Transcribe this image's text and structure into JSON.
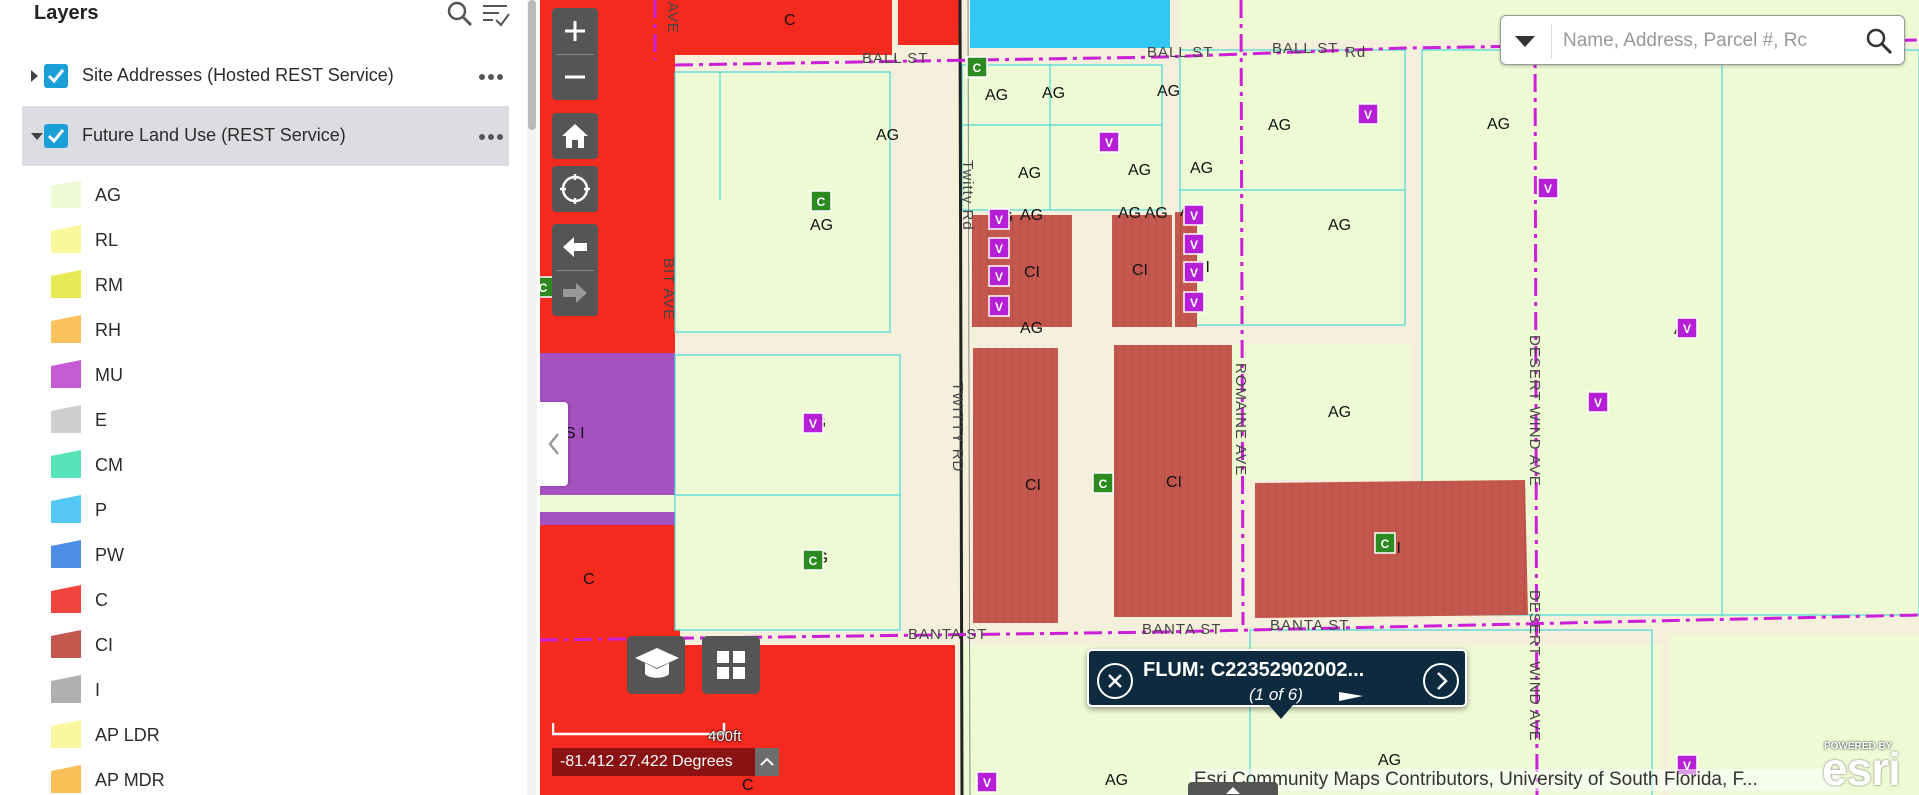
{
  "panel": {
    "title": "Layers",
    "layers": [
      {
        "label": "Site Addresses (Hosted REST Service)",
        "checked": true,
        "expanded": false
      },
      {
        "label": "Future Land Use (REST Service)",
        "checked": true,
        "expanded": true
      }
    ],
    "legend": [
      {
        "code": "AG",
        "color": "#eefad4"
      },
      {
        "code": "RL",
        "color": "#fbf79b"
      },
      {
        "code": "RM",
        "color": "#e6ea55"
      },
      {
        "code": "RH",
        "color": "#fbc15c"
      },
      {
        "code": "MU",
        "color": "#c65bd6"
      },
      {
        "code": "E",
        "color": "#cfcfcf"
      },
      {
        "code": "CM",
        "color": "#58e3b9"
      },
      {
        "code": "P",
        "color": "#55c8f5"
      },
      {
        "code": "PW",
        "color": "#4f8ee6"
      },
      {
        "code": "C",
        "color": "#f0453f"
      },
      {
        "code": "CI",
        "color": "#c4584e"
      },
      {
        "code": "I",
        "color": "#b0b0b0"
      },
      {
        "code": "AP LDR",
        "color": "#fbf7a0"
      },
      {
        "code": "AP MDR",
        "color": "#fbbf58"
      }
    ]
  },
  "map": {
    "search_placeholder": "Name, Address, Parcel #, Rc",
    "roads": {
      "ball_st": "BALL ST",
      "banta_st": "BANTA ST",
      "twitty_rd": "TWITTY RD",
      "twitty_rd_small": "Twitty Rd",
      "romaine_ave": "ROMAINE AVE",
      "desert_wind_ave": "DESERT WIND AVE",
      "bit_ave": "BIT AVE",
      "rd": "Rd",
      "ave": "AVE"
    },
    "labels": {
      "ag": "AG",
      "ci": "CI",
      "c": "C",
      "si": "S I",
      "ag_ag": "AG AG",
      "marker_v": "V",
      "marker_c": "C"
    },
    "popup": {
      "title": "FLUM: C22352902002...",
      "count": "(1 of 6)"
    },
    "scale_label": "400ft",
    "coordinates": "-81.412 27.422 Degrees",
    "attribution": "Esri Community Maps Contributors, University of South Florida, F...",
    "esri_powered": "POWERED BY",
    "esri_word": "esri",
    "colors": {
      "ag": "#eefad4",
      "commercial": "#f52a1f",
      "ci": "#c4584e",
      "mu": "#a452c0",
      "water": "#33c7f4",
      "road": "#f4f0dc",
      "boundary": "#cc1fd8",
      "parcel": "#4ad7d7"
    }
  }
}
